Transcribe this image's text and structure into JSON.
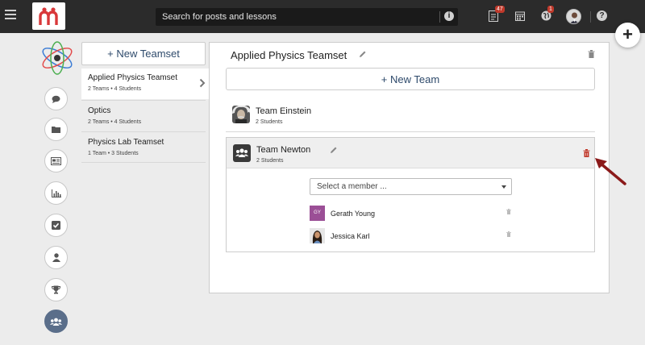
{
  "topbar": {
    "search_placeholder": "Search for posts and lessons",
    "notifications_badge": "47",
    "globe_badge": "1",
    "help": "?"
  },
  "fab_label": "+",
  "teamset_list": {
    "new_label": "+ New Teamset",
    "items": [
      {
        "name": "Applied Physics Teamset",
        "meta": "2 Teams • 4 Students"
      },
      {
        "name": "Optics",
        "meta": "2 Teams • 4 Students"
      },
      {
        "name": "Physics Lab Teamset",
        "meta": "1 Team • 3 Students"
      }
    ]
  },
  "panel": {
    "title": "Applied Physics Teamset",
    "new_team_label": "+ New Team",
    "teams": [
      {
        "name": "Team Einstein",
        "meta": "2 Students"
      },
      {
        "name": "Team Newton",
        "meta": "2 Students"
      }
    ],
    "member_select_placeholder": "Select a member ...",
    "members": [
      {
        "name": "Gerath Young",
        "initials": "GY",
        "color": "#9b4f96"
      },
      {
        "name": "Jessica Karl"
      }
    ]
  },
  "colors": {
    "accent_navy": "#2e4a6b",
    "delete_red": "#c0392b",
    "arrow_red": "#8b1a1a",
    "active_nav": "#5a6e8a"
  }
}
